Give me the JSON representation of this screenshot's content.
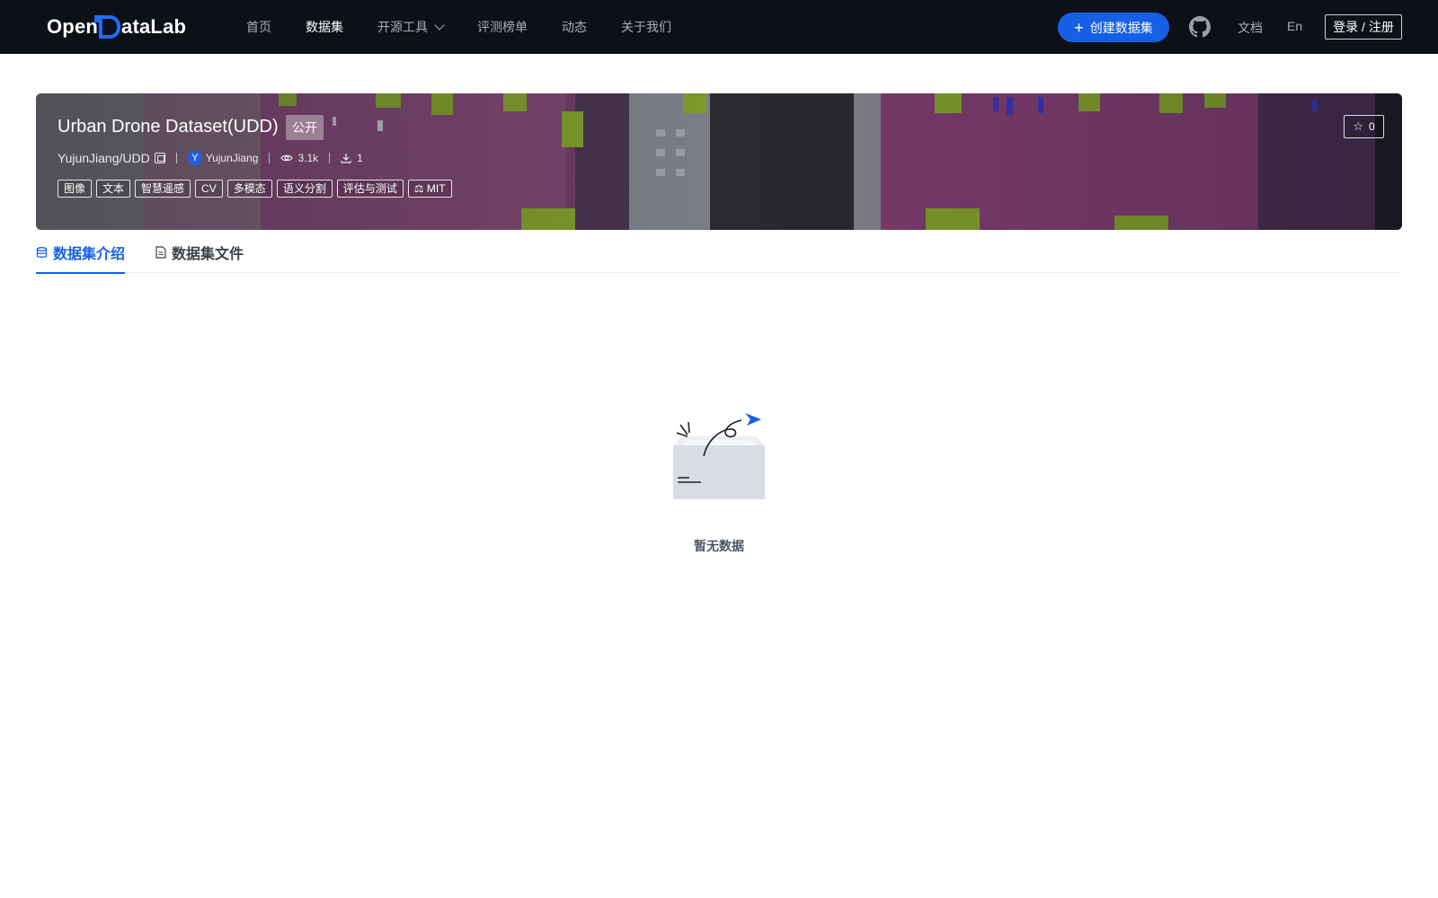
{
  "nav": {
    "logo_text_left": "Open",
    "logo_text_right": "ataLab",
    "items": [
      {
        "label": "首页",
        "active": false
      },
      {
        "label": "数据集",
        "active": true
      },
      {
        "label": "开源工具",
        "active": false,
        "has_dropdown": true
      },
      {
        "label": "评测榜单",
        "active": false
      },
      {
        "label": "动态",
        "active": false
      },
      {
        "label": "关于我们",
        "active": false
      }
    ],
    "create_button": "创建数据集",
    "docs_link": "文档",
    "lang_link": "En",
    "login_button": "登录 / 注册",
    "github_icon": "github-icon"
  },
  "dataset": {
    "title": "Urban Drone Dataset(UDD)",
    "visibility": "公开",
    "repo_path": "YujunJiang/UDD",
    "avatar_letter": "Y",
    "owner": "YujunJiang",
    "views": "3.1k",
    "downloads": "1",
    "stars": "0",
    "tags": [
      "图像",
      "文本",
      "智慧遥感",
      "CV",
      "多模态",
      "语义分割",
      "评估与测试"
    ],
    "license": "MIT"
  },
  "tabs": [
    {
      "label": "数据集介绍",
      "active": true,
      "icon": "database-icon"
    },
    {
      "label": "数据集文件",
      "active": false,
      "icon": "file-icon"
    }
  ],
  "empty": {
    "text": "暂无数据"
  },
  "colors": {
    "nav_bg": "#0d1117",
    "accent": "#1660e6"
  }
}
